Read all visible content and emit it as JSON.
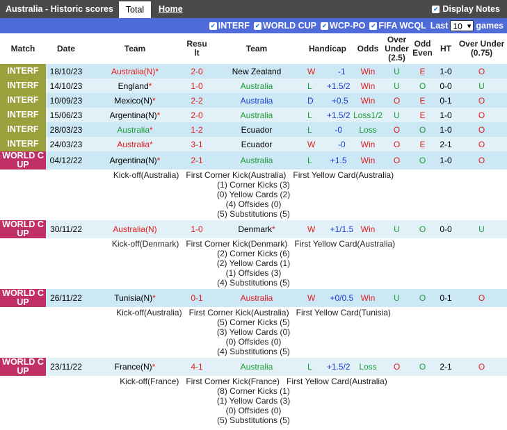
{
  "header": {
    "title": "Australia - Historic scores",
    "tab_total": "Total",
    "tab_home": "Home",
    "display_notes": "Display Notes"
  },
  "filters": {
    "items": [
      "INTERF",
      "WORLD CUP",
      "WCP-PO",
      "FIFA WCQL"
    ],
    "last_label": "Last",
    "last_value": "10",
    "games_label": "games"
  },
  "columns": [
    "Match",
    "Date",
    "Team",
    "Result",
    "Team",
    "Handicap",
    "Odds",
    "Over Under (2.5)",
    "Odd Even",
    "HT",
    "Over Under (0.75)"
  ],
  "colors": {
    "interf": "#9aa03b",
    "world_cup": "#c13065",
    "win": "#e51a1a",
    "draw": "#1a3fcf",
    "loss": "#1aa033",
    "filter_bar": "#4f6ad9"
  },
  "matches": [
    {
      "comp": "INTERF",
      "type": "interf",
      "date": "18/10/23",
      "home": "Australia(N)",
      "home_mark": "*",
      "home_c": "red",
      "score": "2-0",
      "away": "New Zealand",
      "away_mark": "",
      "away_c": "black",
      "res": "W",
      "res_c": "red",
      "hcp": "-1",
      "odds": "Win",
      "odds_c": "red",
      "ou": "U",
      "ou_c": "green",
      "oe": "E",
      "oe_c": "red",
      "ht": "1-0",
      "ou2": "O",
      "ou2_c": "red"
    },
    {
      "comp": "INTERF",
      "type": "interf",
      "date": "14/10/23",
      "home": "England",
      "home_mark": "*",
      "home_c": "black",
      "score": "1-0",
      "away": "Australia",
      "away_mark": "",
      "away_c": "green",
      "res": "L",
      "res_c": "green",
      "hcp": "+1.5/2",
      "odds": "Win",
      "odds_c": "red",
      "ou": "U",
      "ou_c": "green",
      "oe": "O",
      "oe_c": "green",
      "ht": "0-0",
      "ou2": "U",
      "ou2_c": "green"
    },
    {
      "comp": "INTERF",
      "type": "interf",
      "date": "10/09/23",
      "home": "Mexico(N)",
      "home_mark": "*",
      "home_c": "black",
      "score": "2-2",
      "away": "Australia",
      "away_mark": "",
      "away_c": "blue",
      "res": "D",
      "res_c": "blue",
      "hcp": "+0.5",
      "odds": "Win",
      "odds_c": "red",
      "ou": "O",
      "ou_c": "red",
      "oe": "E",
      "oe_c": "red",
      "ht": "0-1",
      "ou2": "O",
      "ou2_c": "red"
    },
    {
      "comp": "INTERF",
      "type": "interf",
      "date": "15/06/23",
      "home": "Argentina(N)",
      "home_mark": "*",
      "home_c": "black",
      "score": "2-0",
      "away": "Australia",
      "away_mark": "",
      "away_c": "green",
      "res": "L",
      "res_c": "green",
      "hcp": "+1.5/2",
      "odds": "Loss1/2",
      "odds_c": "green",
      "ou": "U",
      "ou_c": "green",
      "oe": "E",
      "oe_c": "red",
      "ht": "1-0",
      "ou2": "O",
      "ou2_c": "red"
    },
    {
      "comp": "INTERF",
      "type": "interf",
      "date": "28/03/23",
      "home": "Australia",
      "home_mark": "*",
      "home_c": "green",
      "score": "1-2",
      "away": "Ecuador",
      "away_mark": "",
      "away_c": "black",
      "res": "L",
      "res_c": "green",
      "hcp": "-0",
      "odds": "Loss",
      "odds_c": "green",
      "ou": "O",
      "ou_c": "red",
      "oe": "O",
      "oe_c": "green",
      "ht": "1-0",
      "ou2": "O",
      "ou2_c": "red"
    },
    {
      "comp": "INTERF",
      "type": "interf",
      "date": "24/03/23",
      "home": "Australia",
      "home_mark": "*",
      "home_c": "red",
      "score": "3-1",
      "away": "Ecuador",
      "away_mark": "",
      "away_c": "black",
      "res": "W",
      "res_c": "red",
      "hcp": "-0",
      "odds": "Win",
      "odds_c": "red",
      "ou": "O",
      "ou_c": "red",
      "oe": "E",
      "oe_c": "red",
      "ht": "2-1",
      "ou2": "O",
      "ou2_c": "red"
    },
    {
      "comp": "WORLD C UP",
      "type": "wc",
      "date": "04/12/22",
      "home": "Argentina(N)",
      "home_mark": "*",
      "home_c": "black",
      "score": "2-1",
      "away": "Australia",
      "away_mark": "",
      "away_c": "green",
      "res": "L",
      "res_c": "green",
      "hcp": "+1.5",
      "odds": "Win",
      "odds_c": "red",
      "ou": "O",
      "ou_c": "red",
      "oe": "O",
      "oe_c": "green",
      "ht": "1-0",
      "ou2": "O",
      "ou2_c": "red",
      "note": {
        "line1": "Kick-off(Australia)   First Corner Kick(Australia)   First Yellow Card(Australia)",
        "lines": [
          "(1) Corner Kicks (3)",
          "(0) Yellow Cards (2)",
          "(4) Offsides (0)",
          "(5) Substitutions (5)"
        ]
      }
    },
    {
      "comp": "WORLD C UP",
      "type": "wc",
      "date": "30/11/22",
      "home": "Australia(N)",
      "home_mark": "",
      "home_c": "red",
      "score": "1-0",
      "away": "Denmark",
      "away_mark": "*",
      "away_c": "black",
      "res": "W",
      "res_c": "red",
      "hcp": "+1/1.5",
      "odds": "Win",
      "odds_c": "red",
      "ou": "U",
      "ou_c": "green",
      "oe": "O",
      "oe_c": "green",
      "ht": "0-0",
      "ou2": "U",
      "ou2_c": "green",
      "note": {
        "line1": "Kick-off(Denmark)   First Corner Kick(Denmark)   First Yellow Card(Australia)",
        "lines": [
          "(2) Corner Kicks (6)",
          "(2) Yellow Cards (1)",
          "(1) Offsides (3)",
          "(4) Substitutions (5)"
        ]
      }
    },
    {
      "comp": "WORLD C UP",
      "type": "wc",
      "date": "26/11/22",
      "home": "Tunisia(N)",
      "home_mark": "*",
      "home_c": "black",
      "score": "0-1",
      "away": "Australia",
      "away_mark": "",
      "away_c": "red",
      "res": "W",
      "res_c": "red",
      "hcp": "+0/0.5",
      "odds": "Win",
      "odds_c": "red",
      "ou": "U",
      "ou_c": "green",
      "oe": "O",
      "oe_c": "green",
      "ht": "0-1",
      "ou2": "O",
      "ou2_c": "red",
      "note": {
        "line1": "Kick-off(Australia)   First Corner Kick(Australia)   First Yellow Card(Tunisia)",
        "lines": [
          "(5) Corner Kicks (5)",
          "(3) Yellow Cards (0)",
          "(0) Offsides (0)",
          "(4) Substitutions (5)"
        ]
      }
    },
    {
      "comp": "WORLD C UP",
      "type": "wc",
      "date": "23/11/22",
      "home": "France(N)",
      "home_mark": "*",
      "home_c": "black",
      "score": "4-1",
      "away": "Australia",
      "away_mark": "",
      "away_c": "green",
      "res": "L",
      "res_c": "green",
      "hcp": "+1.5/2",
      "odds": "Loss",
      "odds_c": "green",
      "ou": "O",
      "ou_c": "red",
      "oe": "O",
      "oe_c": "green",
      "ht": "2-1",
      "ou2": "O",
      "ou2_c": "red",
      "note": {
        "line1": "Kick-off(France)   First Corner Kick(France)   First Yellow Card(Australia)",
        "lines": [
          "(8) Corner Kicks (1)",
          "(1) Yellow Cards (3)",
          "(0) Offsides (0)",
          "(5) Substitutions (5)"
        ]
      }
    }
  ]
}
